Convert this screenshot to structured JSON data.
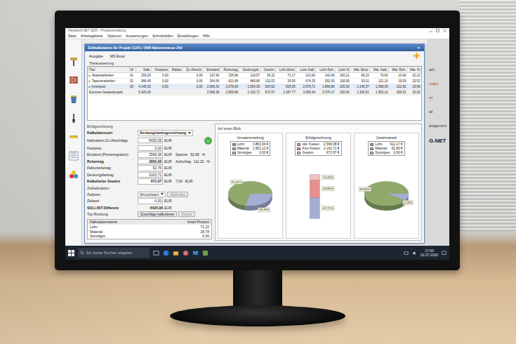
{
  "window": {
    "title": "Handwerk.NET 2020 – Projektverwaltung",
    "menu": [
      "Datei",
      "Arbeitsgebiete",
      "Optionen",
      "Auswertungen",
      "Schnittstellen",
      "Einstellungen",
      "Hilfe"
    ]
  },
  "side_panel": {
    "items": [
      {
        "label": "ach",
        "highlight": false
      },
      {
        "label": "ungen",
        "highlight": true
      },
      {
        "label": "ert",
        "highlight": true
      },
      {
        "label": "all",
        "highlight": false
      },
      {
        "label": "anagement",
        "highlight": false
      }
    ],
    "logo": "G.NET"
  },
  "dialog": {
    "title": "Zeitkalkulation für Projekt 11241 / BWI Nebenstrasse 24d",
    "close": "×",
    "actions": [
      "Ausgabe",
      "MS Excel"
    ]
  },
  "table": {
    "section": "Titelauswertung",
    "columns": [
      "Titel",
      "Nr",
      "Kalk.",
      "Festpreis",
      "Rabatt",
      "Zu-/Abschl.",
      "Einstand",
      "Rohertrag",
      "Deckungsb.",
      "Gewinn",
      "Lohn Einst.",
      "Lohn Kalk.",
      "Lohn Roh.",
      "Lohn %",
      "Mat. Einst.",
      "Mat. Kalk.",
      "Mat. Roh.",
      "Mat. %"
    ],
    "rows": [
      {
        "kind": "title",
        "toggle": "▸",
        "expanded": false,
        "selected": false,
        "cells": [
          "Abdeckarbeiten",
          "01",
          "293,29",
          "0,00",
          "",
          "0,00",
          "137,40",
          "155,89",
          "119,57",
          "36,32",
          "71,17",
          "213,66",
          "142,49",
          "200,21",
          "66,23",
          "79,63",
          "13,40",
          "20,22"
        ]
      },
      {
        "kind": "title",
        "toggle": "▸",
        "expanded": false,
        "selected": false,
        "cells": [
          "Tapezierarbeiten",
          "02",
          "986,45",
          "0,00",
          "",
          "0,00",
          "364,56",
          "621,89",
          "489,86",
          "132,03",
          "29,55",
          "674,35",
          "592,00",
          "199,90",
          "93,01",
          "112,10",
          "19,09",
          "20,52"
        ]
      },
      {
        "kind": "title",
        "toggle": "▸",
        "expanded": false,
        "selected": true,
        "cells": [
          "Innenputz",
          "03",
          "4.145,32",
          "0,00",
          "",
          "0,00",
          "2.066,42",
          "2.078,90",
          "1.554,29",
          "524,62",
          "505,05",
          "2.578,71",
          "1.856,86",
          "200,00",
          "1.145,37",
          "1.368,39",
          "222,92",
          "19,69"
        ]
      },
      {
        "kind": "sum",
        "selected": false,
        "cells": [
          "Summen Gesamtprojekt",
          "",
          "5.425,06",
          "",
          "",
          "",
          "2.568,38",
          "2.856,68",
          "2.163,71",
          "672,97",
          "1.287,77",
          "3.083,44",
          "2.576,17",
          "200,00",
          "1.300,61",
          "1.563,12",
          "260,51",
          "20,03"
        ]
      }
    ]
  },
  "calc": {
    "section": "Erfolgsrechnung",
    "rows": [
      {
        "kind": "select",
        "label": "Kalkulationsart",
        "value": "Deckungsbeitragsrechnung",
        "bold": true
      },
      {
        "kind": "field",
        "label": "Kalkulation Zu-/Abschläge",
        "value": "5425,06",
        "unit": "EUR",
        "bold": false,
        "status": "good"
      },
      {
        "kind": "field",
        "label": "Festpreis",
        "value": "0,00",
        "unit": "EUR",
        "bold": false
      },
      {
        "kind": "field",
        "label": "Einstand (Preisintegration)",
        "value": "2568,38",
        "unit": "EUR",
        "bold": false,
        "extra": [
          "Spanne",
          "52,66",
          "%"
        ]
      },
      {
        "kind": "field",
        "label": "Rohertrag",
        "value": "2856,68",
        "unit": "EUR",
        "bold": true,
        "extra": [
          "Aufschlag",
          "111,22",
          "%"
        ]
      },
      {
        "kind": "field",
        "label": "Fakturierbetrag",
        "value": "92,76",
        "unit": "EUR",
        "bold": false
      },
      {
        "kind": "field",
        "label": "Deckungsbeitrag",
        "value": "2163,71",
        "unit": "EUR",
        "bold": false
      },
      {
        "kind": "field",
        "label": "Kalkulierter Gewinn",
        "value": "672,97",
        "unit": "EUR",
        "bold": true,
        "extra": [
          "7,00",
          "EUR"
        ]
      }
    ],
    "target_section": "Zielkalkulation",
    "target_rows": [
      {
        "kind": "select",
        "label": "Zielpreis",
        "value": "Wunschwert",
        "bold": false,
        "buttons": [
          {
            "label": "Zielfinden",
            "disabled": true
          }
        ]
      },
      {
        "kind": "field",
        "label": "Zielwert",
        "value": "0,00",
        "unit": "EUR",
        "bold": false
      },
      {
        "kind": "text",
        "label": "SOLL/IST-Differenz",
        "value": "-5425,06",
        "unit": "EUR",
        "bold": true
      },
      {
        "kind": "text",
        "label": "Typ Rundung",
        "bold": false,
        "buttons": [
          {
            "label": "Zuschläge kalkulieren",
            "disabled": false
          },
          {
            "label": "Zurück",
            "disabled": true
          }
        ]
      }
    ],
    "shares": {
      "columns": [
        "Kalkulationswerte",
        "Anteil Prozent"
      ],
      "rows": [
        [
          "Lohn",
          "71,22"
        ],
        [
          "Material",
          "28,78"
        ],
        [
          "Sonstiges",
          "0,00"
        ]
      ]
    }
  },
  "overview": {
    "title": "Auf einen Blick",
    "charts": [
      {
        "kind": "pie",
        "title": "Umsatzverteilung",
        "items": [
          {
            "label": "Lohn",
            "value": "3.863,94 €",
            "share": 71.22,
            "share_label": "71,22%",
            "color": "#8faa6b"
          },
          {
            "label": "Material",
            "value": "1.561,12 €",
            "share": 28.78,
            "share_label": "28,78%",
            "color": "#a4aed4"
          },
          {
            "label": "Sonstiges",
            "value": "0,00 €",
            "share": 0,
            "color": "#e59a9a"
          }
        ]
      },
      {
        "kind": "bar",
        "title": "Erfolgsrechnung",
        "items": [
          {
            "label": "Var. Kosten",
            "value": "2.568,38 €",
            "share": 47.71,
            "share_label": "47,71%",
            "color": "#a4aed4"
          },
          {
            "label": "Fixe Kosten",
            "value": "2.163,71 €",
            "share": 39.89,
            "share_label": "39,89%",
            "color": "#e68f8f"
          },
          {
            "label": "Gewinn",
            "value": "672,97 €",
            "share": 12.4,
            "share_label": "12,40%",
            "color": "#f3c1c1"
          }
        ]
      },
      {
        "kind": "pie",
        "title": "Gewinnanteil",
        "items": [
          {
            "label": "Lohn",
            "value": "611,17 €",
            "share": 90.82,
            "share_label": "90,82%",
            "color": "#8faa6b"
          },
          {
            "label": "Material",
            "value": "61,80 €",
            "share": 9.18,
            "share_label": "9,18%",
            "color": "#a4aed4"
          },
          {
            "label": "Sonstiges",
            "value": "0,00 €",
            "share": 0,
            "color": "#e59a9a"
          }
        ]
      }
    ]
  },
  "taskbar": {
    "search": {
      "placeholder": "Zur Suche Text hier eingeben"
    },
    "time": "17:00",
    "date": "02.07.2020"
  }
}
